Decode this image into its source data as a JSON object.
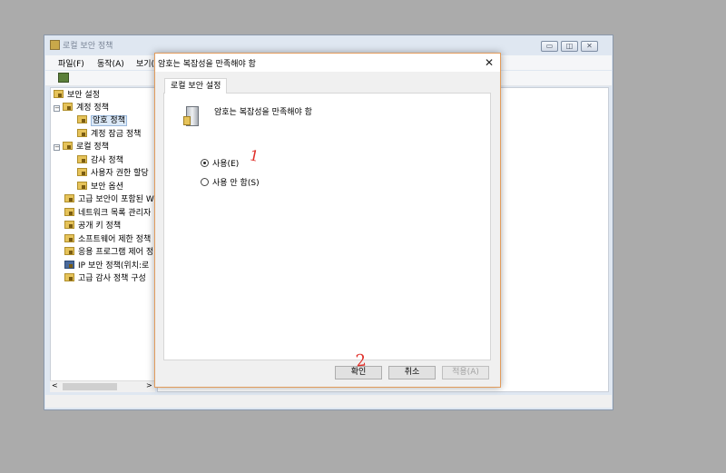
{
  "main_window": {
    "title": "로컬 보안 정책",
    "menu": [
      "파일(F)",
      "동작(A)",
      "보기("
    ],
    "caption_buttons": [
      "minimize",
      "restore",
      "close"
    ]
  },
  "tree": {
    "root": "보안 설정",
    "items": [
      {
        "label": "계정 정책",
        "level": 1,
        "expand": "⊟"
      },
      {
        "label": "암호 정책",
        "level": 2,
        "selected": true
      },
      {
        "label": "계정 잠금 정책",
        "level": 2
      },
      {
        "label": "로컬 정책",
        "level": 1,
        "expand": "⊟"
      },
      {
        "label": "감사 정책",
        "level": 2
      },
      {
        "label": "사용자 권한 할당",
        "level": 2
      },
      {
        "label": "보안 옵션",
        "level": 2
      },
      {
        "label": "고급 보안이 포함된 W",
        "level": 1
      },
      {
        "label": "네트워크 목록 관리자",
        "level": 1
      },
      {
        "label": "공개 키 정책",
        "level": 1
      },
      {
        "label": "소프트웨어 제한 정책",
        "level": 1
      },
      {
        "label": "응용 프로그램 제어 정",
        "level": 1
      },
      {
        "label": "IP 보안 정책(위치:로",
        "level": 1
      },
      {
        "label": "고급 감사 정책 구성",
        "level": 1
      }
    ],
    "scroll_left": "<",
    "scroll_right": ">"
  },
  "dialog": {
    "title": "암호는 복잡성을 만족해야 함",
    "close_glyph": "✕",
    "tab": "로컬 보안 설정",
    "policy_name": "암호는 복잡성을 만족해야 함",
    "options": [
      {
        "label": "사용(E)",
        "checked": true
      },
      {
        "label": "사용 안 함(S)",
        "checked": false
      }
    ],
    "buttons": {
      "ok": "확인",
      "cancel": "취소",
      "apply": "적용(A)"
    }
  },
  "annotations": {
    "mark1": "1",
    "mark2": "2",
    "color": "#e0302a"
  }
}
